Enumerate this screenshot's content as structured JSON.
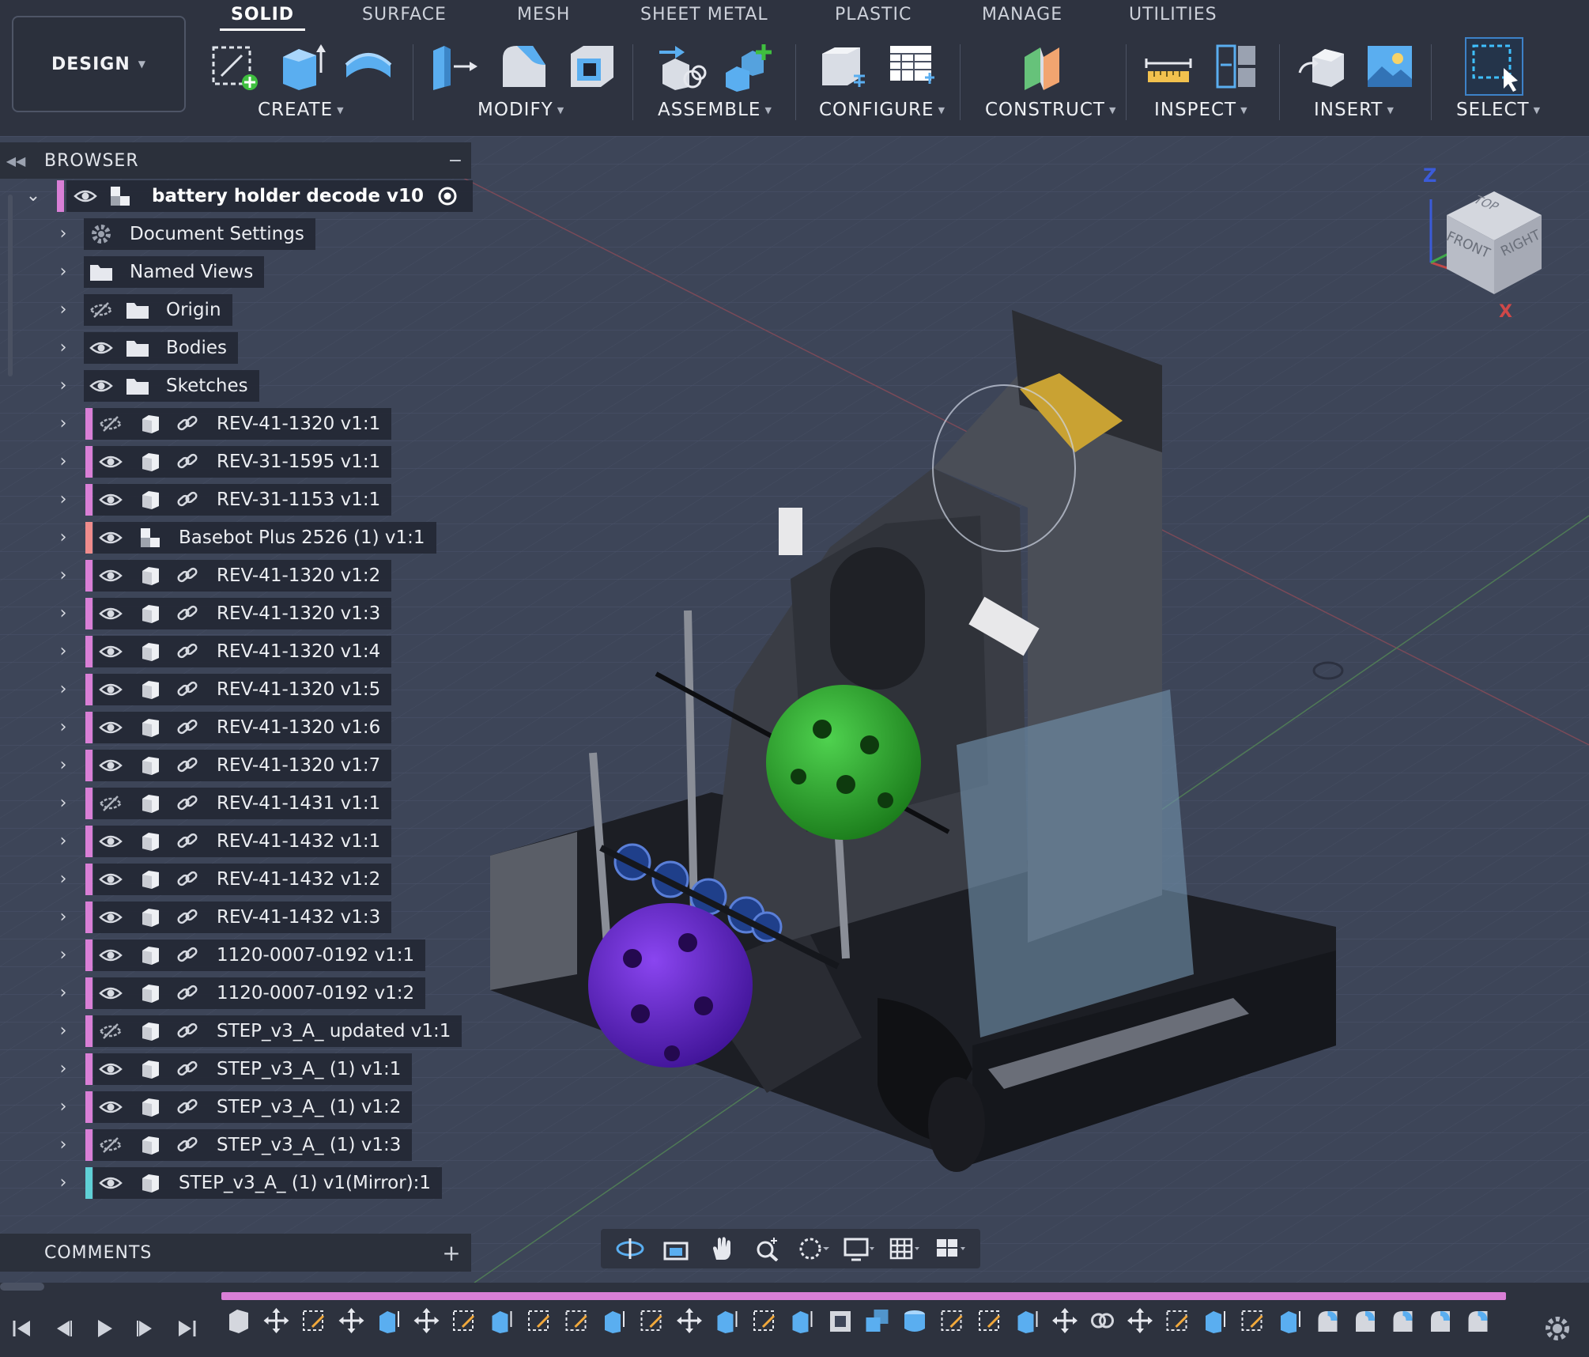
{
  "workspace": {
    "label": "DESIGN"
  },
  "tabs": [
    {
      "label": "SOLID",
      "active": true
    },
    {
      "label": "SURFACE"
    },
    {
      "label": "MESH"
    },
    {
      "label": "SHEET METAL"
    },
    {
      "label": "PLASTIC"
    },
    {
      "label": "MANAGE"
    },
    {
      "label": "UTILITIES"
    }
  ],
  "toolbar_groups": [
    {
      "label": "CREATE"
    },
    {
      "label": "MODIFY"
    },
    {
      "label": "ASSEMBLE"
    },
    {
      "label": "CONFIGURE"
    },
    {
      "label": "CONSTRUCT"
    },
    {
      "label": "INSPECT"
    },
    {
      "label": "INSERT"
    },
    {
      "label": "SELECT"
    }
  ],
  "browser": {
    "title": "BROWSER",
    "root": {
      "label": "battery holder decode v10"
    },
    "items": [
      {
        "label": "Document Settings",
        "icon": "gear-icon"
      },
      {
        "label": "Named Views",
        "icon": "folder-icon"
      },
      {
        "label": "Origin",
        "icon": "folder-icon",
        "visible": false
      },
      {
        "label": "Bodies",
        "icon": "folder-icon",
        "visible": true
      },
      {
        "label": "Sketches",
        "icon": "folder-icon",
        "visible": true
      },
      {
        "label": "REV-41-1320 v1:1",
        "visible": false,
        "linked": true
      },
      {
        "label": "REV-31-1595 v1:1",
        "visible": true,
        "linked": true
      },
      {
        "label": "REV-31-1153 v1:1",
        "visible": true,
        "linked": true
      },
      {
        "label": "Basebot Plus 2526 (1) v1:1",
        "visible": true,
        "linked": false
      },
      {
        "label": "REV-41-1320 v1:2",
        "visible": true,
        "linked": true
      },
      {
        "label": "REV-41-1320 v1:3",
        "visible": true,
        "linked": true
      },
      {
        "label": "REV-41-1320 v1:4",
        "visible": true,
        "linked": true
      },
      {
        "label": "REV-41-1320 v1:5",
        "visible": true,
        "linked": true
      },
      {
        "label": "REV-41-1320 v1:6",
        "visible": true,
        "linked": true
      },
      {
        "label": "REV-41-1320 v1:7",
        "visible": true,
        "linked": true
      },
      {
        "label": "REV-41-1431 v1:1",
        "visible": false,
        "linked": true
      },
      {
        "label": "REV-41-1432 v1:1",
        "visible": true,
        "linked": true
      },
      {
        "label": "REV-41-1432 v1:2",
        "visible": true,
        "linked": true
      },
      {
        "label": "REV-41-1432 v1:3",
        "visible": true,
        "linked": true
      },
      {
        "label": "1120-0007-0192 v1:1",
        "visible": true,
        "linked": true
      },
      {
        "label": "1120-0007-0192 v1:2",
        "visible": true,
        "linked": true
      },
      {
        "label": "STEP_v3_A_ updated v1:1",
        "visible": false,
        "linked": true
      },
      {
        "label": "STEP_v3_A_ (1) v1:1",
        "visible": true,
        "linked": true
      },
      {
        "label": "STEP_v3_A_ (1) v1:2",
        "visible": true,
        "linked": true
      },
      {
        "label": "STEP_v3_A_ (1) v1:3",
        "visible": false,
        "linked": true
      },
      {
        "label": "STEP_v3_A_ (1) v1(Mirror):1",
        "visible": true,
        "linked": false
      }
    ]
  },
  "comments": {
    "title": "COMMENTS"
  },
  "viewcube": {
    "top": "TOP",
    "front": "FRONT",
    "right": "RIGHT",
    "axis_z": "Z",
    "axis_x": "X"
  },
  "colors": {
    "accent_component": "#d97fd6",
    "accent_subassembly": "#f08c8c",
    "accent_mirror": "#5fd0d6",
    "timeline": "#d97fd6"
  }
}
